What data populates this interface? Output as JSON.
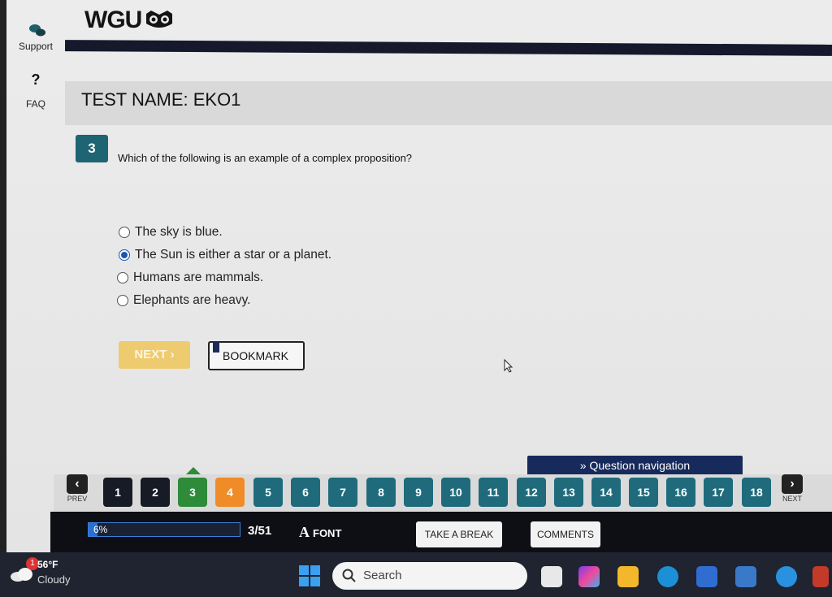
{
  "sidebar": {
    "support_label": "Support",
    "faq_symbol": "?",
    "faq_label": "FAQ"
  },
  "header": {
    "logo_text": "WGU"
  },
  "test": {
    "title": "TEST NAME:  EKO1"
  },
  "question": {
    "number": "3",
    "text": "Which of the following is an example of a complex proposition?",
    "options": [
      {
        "label": "The sky is blue.",
        "selected": false
      },
      {
        "label": "The Sun is either a star or a planet.",
        "selected": true
      },
      {
        "label": "Humans are mammals.",
        "selected": false
      },
      {
        "label": "Elephants are heavy.",
        "selected": false
      }
    ]
  },
  "actions": {
    "next_label": "NEXT ›",
    "bookmark_label": "BOOKMARK"
  },
  "navigation": {
    "toggle_label": "» Question navigation",
    "prev_label": "PREV",
    "next_label": "NEXT",
    "prev_symbol": "‹",
    "next_symbol": "›",
    "questions": [
      {
        "n": "1",
        "state": "answered"
      },
      {
        "n": "2",
        "state": "answered"
      },
      {
        "n": "3",
        "state": "current"
      },
      {
        "n": "4",
        "state": "flagged"
      },
      {
        "n": "5",
        "state": "unanswered"
      },
      {
        "n": "6",
        "state": "unanswered"
      },
      {
        "n": "7",
        "state": "unanswered"
      },
      {
        "n": "8",
        "state": "unanswered"
      },
      {
        "n": "9",
        "state": "unanswered"
      },
      {
        "n": "10",
        "state": "unanswered"
      },
      {
        "n": "11",
        "state": "unanswered"
      },
      {
        "n": "12",
        "state": "unanswered"
      },
      {
        "n": "13",
        "state": "unanswered"
      },
      {
        "n": "14",
        "state": "unanswered"
      },
      {
        "n": "15",
        "state": "unanswered"
      },
      {
        "n": "16",
        "state": "unanswered"
      },
      {
        "n": "17",
        "state": "unanswered"
      },
      {
        "n": "18",
        "state": "unanswered"
      }
    ]
  },
  "footer": {
    "progress_label": "6%",
    "progress_value": 0.06,
    "count": "3/51",
    "font_icon": "A",
    "font_label": "FONT",
    "break_label": "TAKE A BREAK",
    "comments_label": "COMMENTS"
  },
  "taskbar": {
    "notification_count": "1",
    "temperature": "56°F",
    "condition": "Cloudy",
    "search_placeholder": "Search"
  },
  "colors": {
    "accent_teal": "#1f6b7c",
    "current_green": "#2e8b3a",
    "flagged_orange": "#ef8c27",
    "answered_dark": "#161b26",
    "nav_blue": "#172a5c",
    "progress_blue": "#2a6fd3"
  }
}
